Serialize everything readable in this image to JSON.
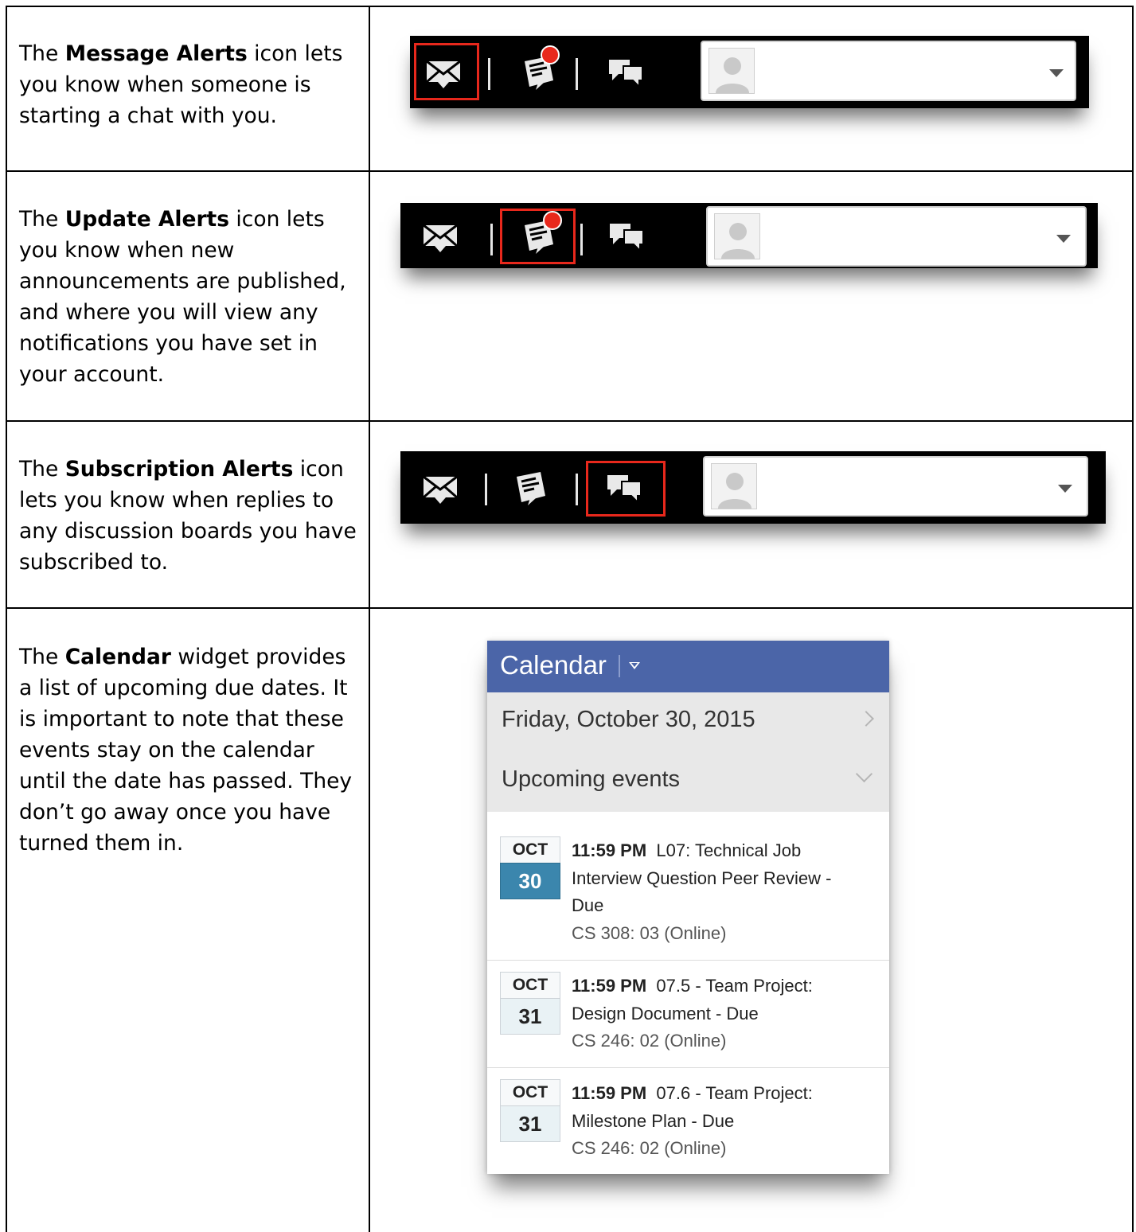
{
  "rows": [
    {
      "prefix": "The ",
      "term": "Message Alerts",
      "suffix": " icon lets you know when someone is starting a chat with you.",
      "highlight": "message"
    },
    {
      "prefix": "The ",
      "term": "Update Alerts",
      "suffix": " icon lets you know when new announcements are published, and where you will view any notifications you have set in your account.",
      "highlight": "update"
    },
    {
      "prefix": "The ",
      "term": "Subscription Alerts",
      "suffix": " icon lets you know when replies to any discussion boards you have subscribed to.",
      "highlight": "subscription"
    },
    {
      "prefix": "The ",
      "term": "Calendar",
      "suffix": " widget provides a list of upcoming due dates. It is important to note that these events stay on the calendar until the date has passed. They don’t go away once you have turned them in."
    }
  ],
  "toolbar": {
    "icons": [
      "envelope-icon",
      "update-alerts-icon",
      "chat-bubbles-icon"
    ],
    "highlight_color": "#e8281c"
  },
  "calendar": {
    "title": "Calendar",
    "date": "Friday, October 30, 2015",
    "section": "Upcoming events",
    "header_color": "#4b65a8",
    "events": [
      {
        "month": "OCT",
        "day": "30",
        "selected": true,
        "time": "11:59 PM",
        "title_lines": [
          "L07: Technical Job",
          "Interview Question Peer Review -",
          "Due"
        ],
        "course": "CS 308: 03 (Online)"
      },
      {
        "month": "OCT",
        "day": "31",
        "selected": false,
        "time": "11:59 PM",
        "title_lines": [
          "07.5 - Team Project:",
          "Design Document - Due"
        ],
        "course": "CS 246: 02 (Online)"
      },
      {
        "month": "OCT",
        "day": "31",
        "selected": false,
        "time": "11:59 PM",
        "title_lines": [
          "07.6 - Team Project:",
          "Milestone Plan - Due"
        ],
        "course": "CS 246: 02 (Online)"
      }
    ]
  }
}
